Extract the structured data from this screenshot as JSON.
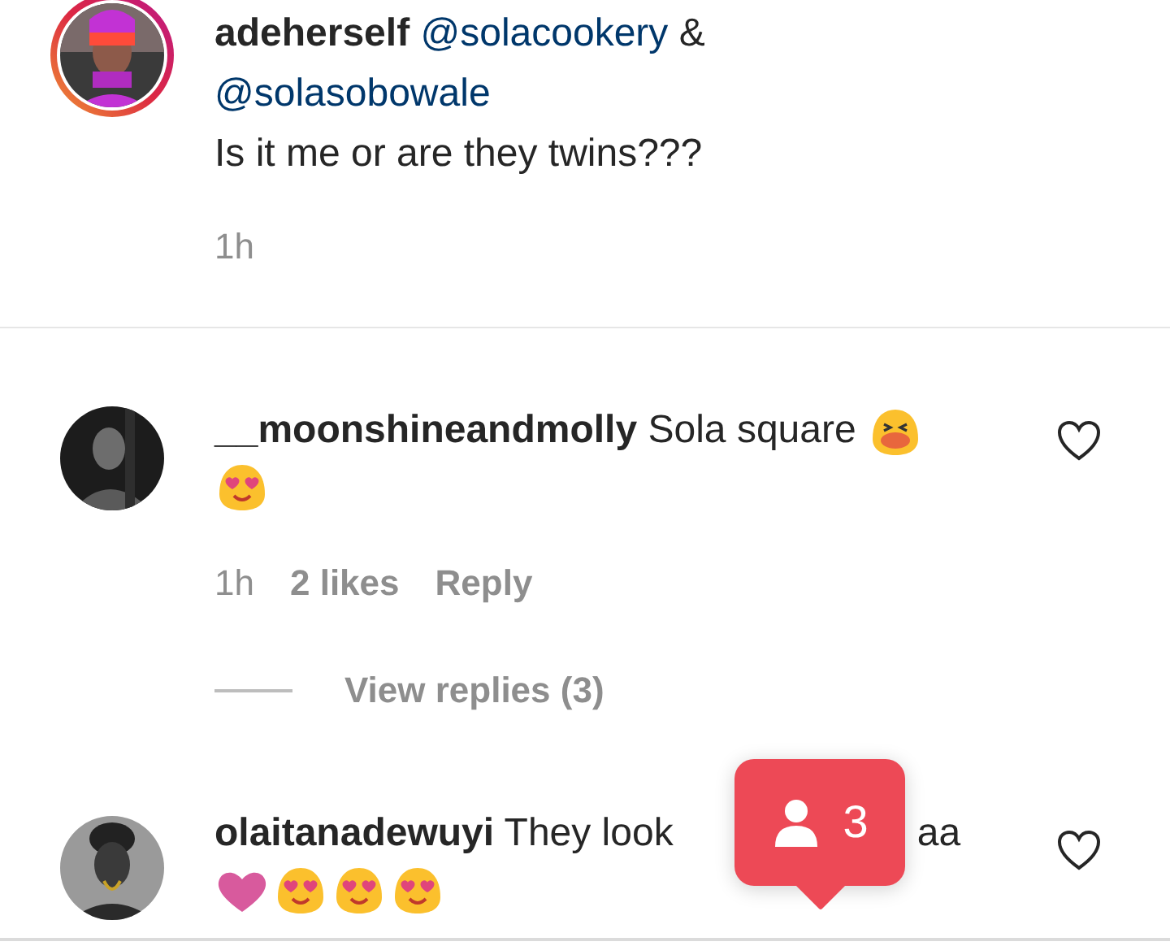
{
  "caption": {
    "username": "adeherself",
    "mentions": [
      "@solacookery",
      "@solasobowale"
    ],
    "joiner": "&",
    "text": "Is it me or are they twins???",
    "time": "1h"
  },
  "comments": [
    {
      "username": "__moonshineandmolly",
      "text": [
        "Sola square"
      ],
      "emojis": [
        {
          "kind": "squint"
        },
        {
          "kind": "heart-eyes"
        }
      ],
      "time": "1h",
      "likes": "2 likes",
      "reply": "Reply",
      "liked": false,
      "view_replies": "View replies (3)"
    },
    {
      "username": "olaitanadewuyi",
      "text": [
        "They look",
        "aa"
      ],
      "emojis": [
        {
          "kind": "heart"
        },
        {
          "kind": "heart-eyes"
        },
        {
          "kind": "heart-eyes"
        },
        {
          "kind": "heart-eyes"
        }
      ],
      "liked": false
    }
  ],
  "notification": {
    "count": "3"
  }
}
